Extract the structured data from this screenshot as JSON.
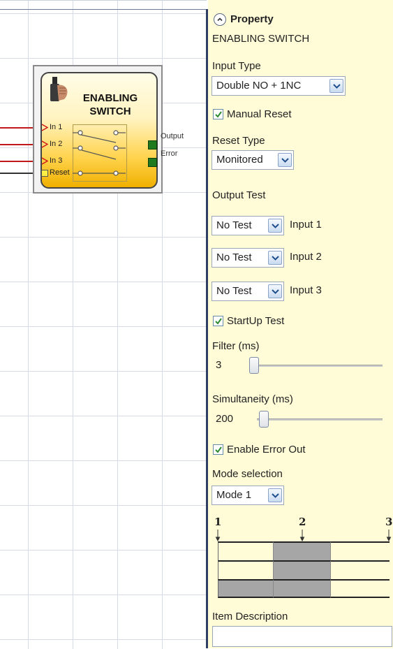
{
  "block": {
    "title_line1": "ENABLING",
    "title_line2": "SWITCH",
    "inputs": [
      "In 1",
      "In 2",
      "In 3",
      "Reset"
    ],
    "outputs": [
      "Output",
      "Error"
    ]
  },
  "panel": {
    "header": "Property",
    "subtitle": "ENABLING SWITCH",
    "input_type": {
      "label": "Input Type",
      "value": "Double NO + 1NC"
    },
    "manual_reset": {
      "label": "Manual Reset",
      "checked": true
    },
    "reset_type": {
      "label": "Reset Type",
      "value": "Monitored"
    },
    "output_test": {
      "label": "Output Test",
      "rows": [
        {
          "value": "No Test",
          "label": "Input 1"
        },
        {
          "value": "No Test",
          "label": "Input 2"
        },
        {
          "value": "No Test",
          "label": "Input 3"
        }
      ]
    },
    "startup_test": {
      "label": "StartUp Test",
      "checked": true
    },
    "filter": {
      "label": "Filter (ms)",
      "value": "3",
      "level": 0.0
    },
    "simultaneity": {
      "label": "Simultaneity (ms)",
      "value": "200",
      "level": 0.03
    },
    "enable_error_out": {
      "label": "Enable Error Out",
      "checked": true
    },
    "mode_selection": {
      "label": "Mode selection",
      "value": "Mode 1"
    },
    "timing_diagram": {
      "positions": [
        "1",
        "2",
        "3"
      ],
      "rows": [
        [
          false,
          true,
          false
        ],
        [
          false,
          true,
          false
        ],
        [
          true,
          true,
          false
        ]
      ]
    },
    "item_description": {
      "label": "Item Description",
      "value": ""
    }
  },
  "colors": {
    "panel_bg": "#fffcd7",
    "block_gradient_bottom": "#f0b000",
    "output_pin": "#1f7a1f",
    "checkbox_check": "#2d8a2d",
    "diagram_on": "#a6a6a6"
  }
}
